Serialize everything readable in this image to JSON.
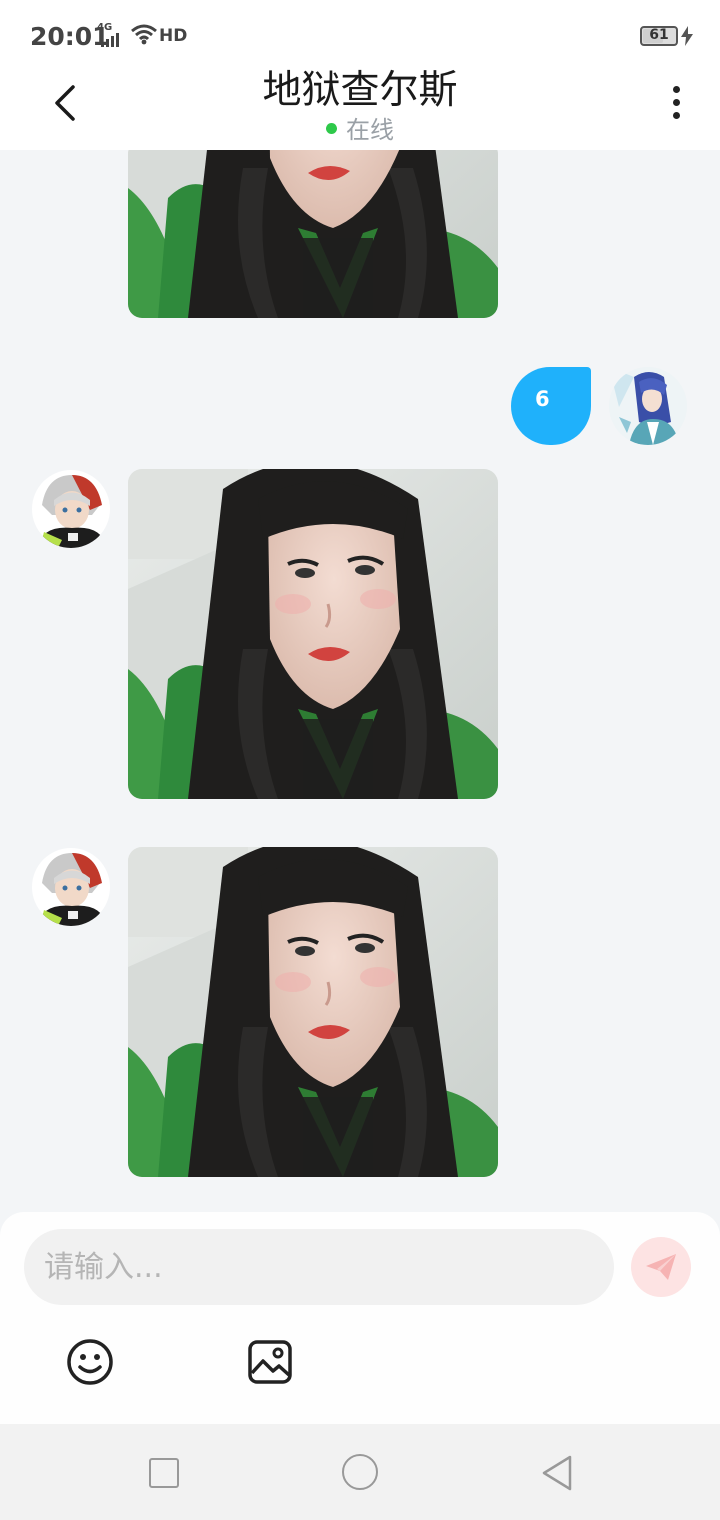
{
  "status_bar": {
    "time": "20:01",
    "network": "4G",
    "hd": "HD",
    "battery": "61",
    "battery_level": 0.61
  },
  "header": {
    "title": "地狱查尔斯",
    "status": "在线",
    "status_color": "#2ec94a"
  },
  "messages": [
    {
      "side": "left",
      "type": "image",
      "content": "portrait photo (partially scrolled)"
    },
    {
      "side": "right",
      "type": "text",
      "text": "6",
      "bubble_color": "#1fb1fb"
    },
    {
      "side": "left",
      "type": "image",
      "content": "portrait photo"
    },
    {
      "side": "left",
      "type": "image",
      "content": "portrait photo"
    }
  ],
  "input": {
    "placeholder": "请输入..."
  },
  "icons": {
    "back": "chevron-left-icon",
    "more": "more-vertical-icon",
    "send": "send-icon",
    "emoji": "emoji-icon",
    "image": "image-icon",
    "nav_recent": "recent-apps-icon",
    "nav_home": "home-icon",
    "nav_back": "back-triangle-icon"
  }
}
